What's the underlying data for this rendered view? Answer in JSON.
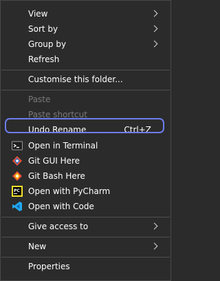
{
  "menu": {
    "view": "View",
    "sort_by": "Sort by",
    "group_by": "Group by",
    "refresh": "Refresh",
    "customise": "Customise this folder...",
    "paste": "Paste",
    "paste_shortcut": "Paste shortcut",
    "undo_rename": "Undo Rename",
    "undo_shortcut": "Ctrl+Z",
    "open_terminal": "Open in Terminal",
    "git_gui": "Git GUI Here",
    "git_bash": "Git Bash Here",
    "pycharm": "Open with PyCharm",
    "vscode": "Open with Code",
    "give_access": "Give access to",
    "new": "New",
    "properties": "Properties"
  },
  "icons": {
    "terminal": "terminal-icon",
    "git_gui": "git-gui-icon",
    "git_bash": "git-bash-icon",
    "pycharm": "pycharm-icon",
    "vscode": "vscode-icon",
    "pycharm_text": "PC"
  },
  "colors": {
    "background": "#2b2b2b",
    "highlight_border": "#6f7cf0",
    "disabled_text": "#7a7a7a",
    "vscode_blue": "#23a9f2",
    "pycharm_yellow": "#f2e12b"
  }
}
